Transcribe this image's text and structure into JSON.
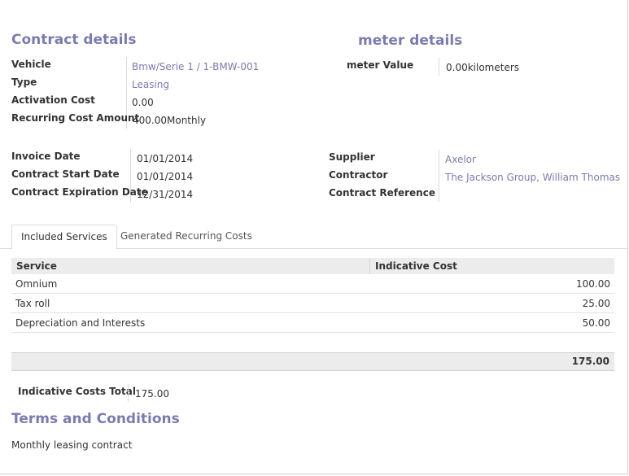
{
  "contract_section": {
    "title": "Contract details",
    "vehicle_label": "Vehicle",
    "vehicle_value": "Bmw/Serie 1 / 1-BMW-001",
    "type_label": "Type",
    "type_value": "Leasing",
    "activation_label": "Activation Cost",
    "activation_value": "0.00",
    "recurring_label": "Recurring Cost Amount",
    "recurring_value": "400.00",
    "recurring_period": "Monthly"
  },
  "odometer_section": {
    "title": "meter details",
    "value_label": "meter Value",
    "value": "0.00",
    "unit": "kilometers"
  },
  "dates": {
    "invoice_label": "Invoice Date",
    "invoice_value": "01/01/2014",
    "start_label": "Contract Start Date",
    "start_value": "01/01/2014",
    "expiration_label": "Contract Expiration Date",
    "expiration_value": "12/31/2014"
  },
  "parties": {
    "supplier_label": "Supplier",
    "supplier_value": "Axelor",
    "contractor_label": "Contractor",
    "contractor_value": "The Jackson Group, William Thomas",
    "reference_label": "Contract Reference",
    "reference_value": ""
  },
  "tabs": {
    "included": "Included Services",
    "generated": "Generated Recurring Costs"
  },
  "services_table": {
    "columns": [
      "Service",
      "Indicative Cost"
    ],
    "rows": [
      {
        "service": "Omnium",
        "cost": "100.00"
      },
      {
        "service": "Tax roll",
        "cost": "25.00"
      },
      {
        "service": "Depreciation and Interests",
        "cost": "50.00"
      }
    ],
    "total": "175.00"
  },
  "totals": {
    "label": "Indicative Costs Total",
    "value": "175.00"
  },
  "terms": {
    "title": "Terms and Conditions",
    "text": "Monthly leasing contract"
  }
}
